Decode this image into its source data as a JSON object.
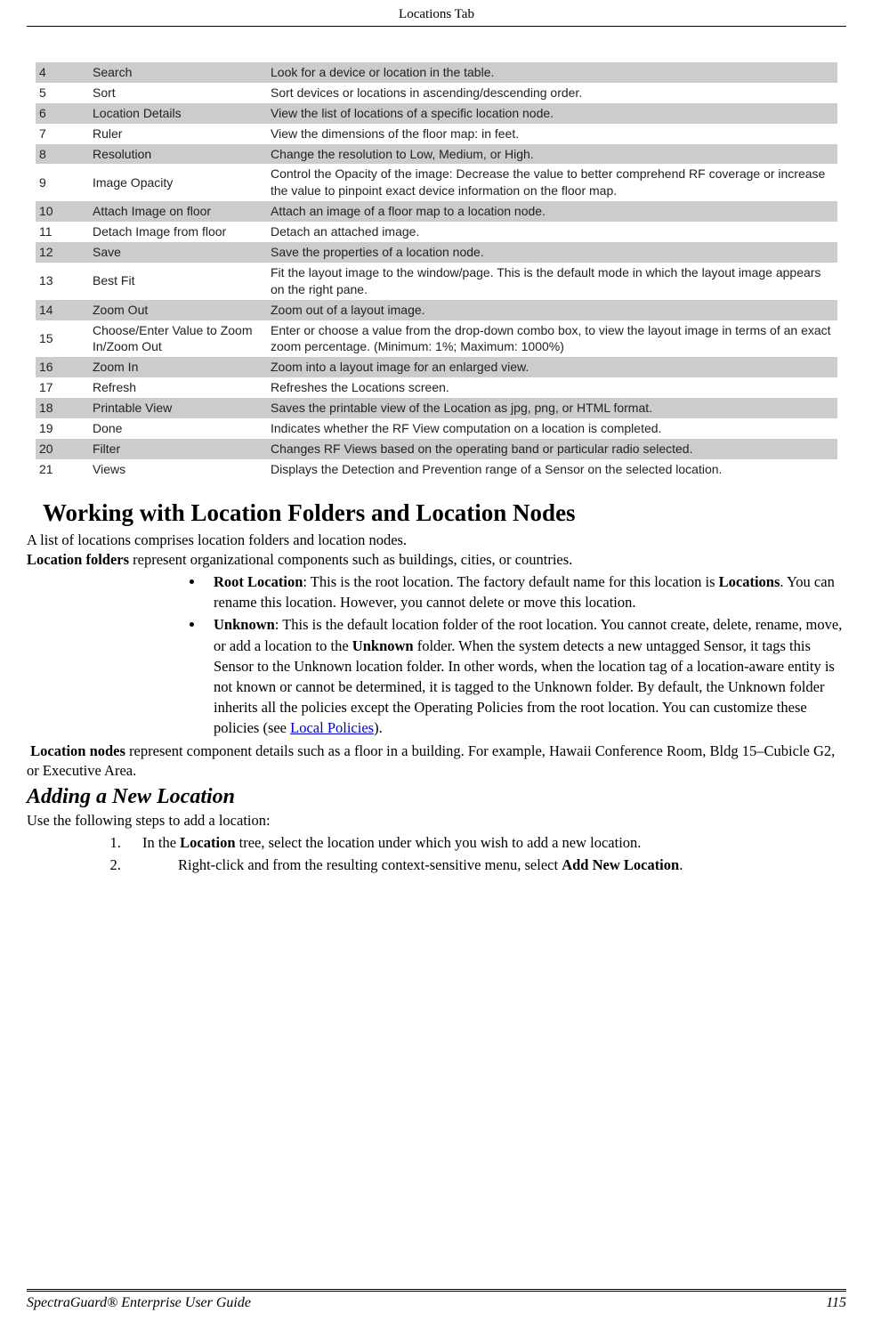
{
  "header": {
    "title": "Locations Tab"
  },
  "table": {
    "rows": [
      {
        "n": "4",
        "name": "Search",
        "desc": "Look for a device or location in the table.",
        "shaded": true
      },
      {
        "n": "5",
        "name": "Sort",
        "desc": "Sort devices or locations in ascending/descending order.",
        "shaded": false
      },
      {
        "n": "6",
        "name": "Location Details",
        "desc": "View the list of locations of a specific location node.",
        "shaded": true
      },
      {
        "n": "7",
        "name": "Ruler",
        "desc": "View the dimensions of the floor map: in feet.",
        "shaded": false
      },
      {
        "n": "8",
        "name": "Resolution",
        "desc": "Change the resolution to Low, Medium, or High.",
        "shaded": true
      },
      {
        "n": "9",
        "name": "Image Opacity",
        "desc": "Control the Opacity of the image: Decrease the value to better comprehend RF coverage or increase the value to pinpoint exact device information on the floor map.",
        "shaded": false
      },
      {
        "n": "10",
        "name": "Attach Image on floor",
        "desc": "Attach an image of a floor map to a location node.",
        "shaded": true
      },
      {
        "n": "11",
        "name": "Detach Image from floor",
        "desc": "Detach an attached image.",
        "shaded": false
      },
      {
        "n": "12",
        "name": "Save",
        "desc": "Save the properties of a location node.",
        "shaded": true
      },
      {
        "n": "13",
        "name": "Best Fit",
        "desc": "Fit the layout image to the window/page. This is the default mode in which the layout image appears on the right pane.",
        "shaded": false
      },
      {
        "n": "14",
        "name": "Zoom Out",
        "desc": "Zoom out of a layout image.",
        "shaded": true
      },
      {
        "n": "15",
        "name": "Choose/Enter Value to Zoom In/Zoom Out",
        "desc": "Enter or choose a value from the drop-down combo box, to view the layout image in terms of an exact zoom percentage. (Minimum: 1%; Maximum: 1000%)",
        "shaded": false
      },
      {
        "n": "16",
        "name": "Zoom In",
        "desc": "Zoom into a layout image for an enlarged view.",
        "shaded": true
      },
      {
        "n": "17",
        "name": "Refresh",
        "desc": "Refreshes the Locations screen.",
        "shaded": false
      },
      {
        "n": "18",
        "name": "Printable View",
        "desc": "Saves the printable view of the Location as jpg, png, or HTML format.",
        "shaded": true
      },
      {
        "n": "19",
        "name": "Done",
        "desc": "Indicates whether the RF View computation on a location is completed.",
        "shaded": false
      },
      {
        "n": "20",
        "name": "Filter",
        "desc": "Changes RF Views based on the operating band or particular radio selected.",
        "shaded": true
      },
      {
        "n": "21",
        "name": "Views",
        "desc": "Displays the Detection and Prevention range of a Sensor on the selected location.",
        "shaded": false
      }
    ]
  },
  "section": {
    "heading": "Working with Location Folders and Location Nodes",
    "intro1": "A list of locations comprises location folders and location nodes.",
    "intro2_bold": "Location folders",
    "intro2_rest": " represent organizational components such as buildings, cities, or countries.",
    "bullets": [
      {
        "bold": "Root Location",
        "text1": ": This is the root location. The factory default name for this location is ",
        "bold2": "Locations",
        "text2": ". You can rename this location. However, you cannot delete or move this location."
      },
      {
        "bold": "Unknown",
        "text1": ": This is the default location folder of the root location. You cannot create, delete, rename, move, or add a location to the ",
        "bold2": "Unknown",
        "text2": " folder. When the system detects a new untagged Sensor, it tags this Sensor to the Unknown location folder. In other words, when the location tag of a location-aware entity is not known or cannot be determined, it is tagged to the Unknown folder. By default, the Unknown folder inherits all the policies except the Operating Policies from the root location. You can customize these policies (see ",
        "link": "Local Policies",
        "text3": ")."
      }
    ],
    "nodes_bold": "Location nodes",
    "nodes_rest": " represent component details such as a floor in a building. For example, Hawaii Conference Room, Bldg 15–Cubicle G2, or Executive Area.",
    "subheading": "Adding a New Location",
    "steps_intro": "Use the following steps to add a location:",
    "steps": [
      {
        "pre": "In the ",
        "bold": "Location",
        "post": " tree, select the location under which you wish to add a new location."
      },
      {
        "pre": "Right-click and from the resulting context-sensitive menu, select ",
        "bold": "Add New Location",
        "post": "."
      }
    ]
  },
  "footer": {
    "left": "SpectraGuard®  Enterprise User Guide",
    "right": "115"
  }
}
